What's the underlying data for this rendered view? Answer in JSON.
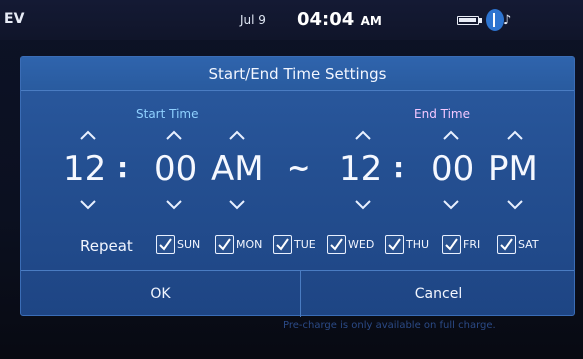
{
  "status_bar": {
    "left_text": "EV",
    "date": "Jul 9",
    "time": "04:04",
    "ampm": "AM",
    "battery_icon": "battery-icon",
    "bluetooth_icon": "bluetooth-icon",
    "music_icon": "music-note-icon",
    "music_glyph": "♪"
  },
  "dialog": {
    "title": "Start/End Time Settings",
    "start_label": "Start Time",
    "end_label": "End Time",
    "start": {
      "hour": "12",
      "minute": "00",
      "meridiem": "AM"
    },
    "end": {
      "hour": "12",
      "minute": "00",
      "meridiem": "PM"
    },
    "separator": ":",
    "range_sep": "~",
    "repeat_label": "Repeat",
    "days": [
      {
        "label": "SUN",
        "checked": true
      },
      {
        "label": "MON",
        "checked": true
      },
      {
        "label": "TUE",
        "checked": true
      },
      {
        "label": "WED",
        "checked": true
      },
      {
        "label": "THU",
        "checked": true
      },
      {
        "label": "FRI",
        "checked": true
      },
      {
        "label": "SAT",
        "checked": true
      }
    ],
    "ok_label": "OK",
    "cancel_label": "Cancel"
  },
  "background_note": "Pre-charge is only available on full charge.",
  "colors": {
    "dialog_bg": "#244f91",
    "start_label": "#8fd1ff",
    "end_label": "#f3c8ff"
  }
}
